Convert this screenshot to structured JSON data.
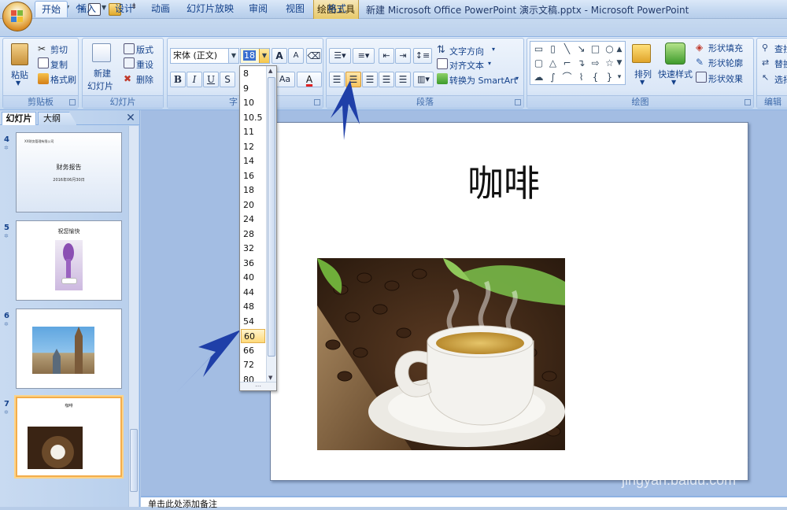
{
  "window": {
    "contextual_tab": "绘图工具",
    "title": "新建 Microsoft Office PowerPoint 演示文稿.pptx - Microsoft PowerPoint"
  },
  "tabs": [
    "开始",
    "插入",
    "设计",
    "动画",
    "幻灯片放映",
    "审阅",
    "视图",
    "格式"
  ],
  "active_tab": "开始",
  "clipboard": {
    "paste": "粘贴",
    "cut": "剪切",
    "copy": "复制",
    "format_painter": "格式刷",
    "label": "剪贴板"
  },
  "slides_group": {
    "new_slide_line1": "新建",
    "new_slide_line2": "幻灯片",
    "layout": "版式",
    "reset": "重设",
    "delete": "删除",
    "label": "幻灯片"
  },
  "font": {
    "family": "宋体 (正文)",
    "size": "18",
    "bold": "B",
    "italic": "I",
    "underline": "U",
    "grow": "A",
    "shrink": "A",
    "aa": "Aa",
    "color_a": "A",
    "label": "字"
  },
  "paragraph": {
    "text_direction": "文字方向",
    "align_text": "对齐文本",
    "to_smartart": "转换为 SmartArt",
    "label": "段落"
  },
  "drawing": {
    "arrange": "排列",
    "quick_styles": "快速样式",
    "shape_fill": "形状填充",
    "shape_outline": "形状轮廓",
    "shape_effects": "形状效果",
    "label": "绘图"
  },
  "editing": {
    "find": "查找",
    "replace": "替换",
    "select": "选择",
    "label": "编辑"
  },
  "font_sizes": [
    "8",
    "9",
    "10",
    "10.5",
    "11",
    "12",
    "14",
    "16",
    "18",
    "20",
    "24",
    "28",
    "32",
    "36",
    "40",
    "44",
    "48",
    "54",
    "60",
    "66",
    "72",
    "80"
  ],
  "hovered_font_size": "60",
  "left_pane": {
    "tab_slides": "幻灯片",
    "tab_outline": "大纲",
    "close": "✕"
  },
  "thumbnails": [
    {
      "num": "4",
      "line1": "XX财务管理有限公司",
      "line2": "财务报告",
      "line3": "2016年06月30日"
    },
    {
      "num": "5",
      "line1": "祝您愉快"
    },
    {
      "num": "6"
    },
    {
      "num": "7",
      "line1": "咖啡"
    }
  ],
  "slide": {
    "title": "咖啡"
  },
  "notes": {
    "placeholder": "单击此处添加备注"
  },
  "watermark": {
    "text": "Bai经验",
    "url": "jingyan.baidu.com"
  },
  "colors": {
    "annotation_arrow": "#1f3fa8",
    "selection": "#f3ad4c"
  }
}
